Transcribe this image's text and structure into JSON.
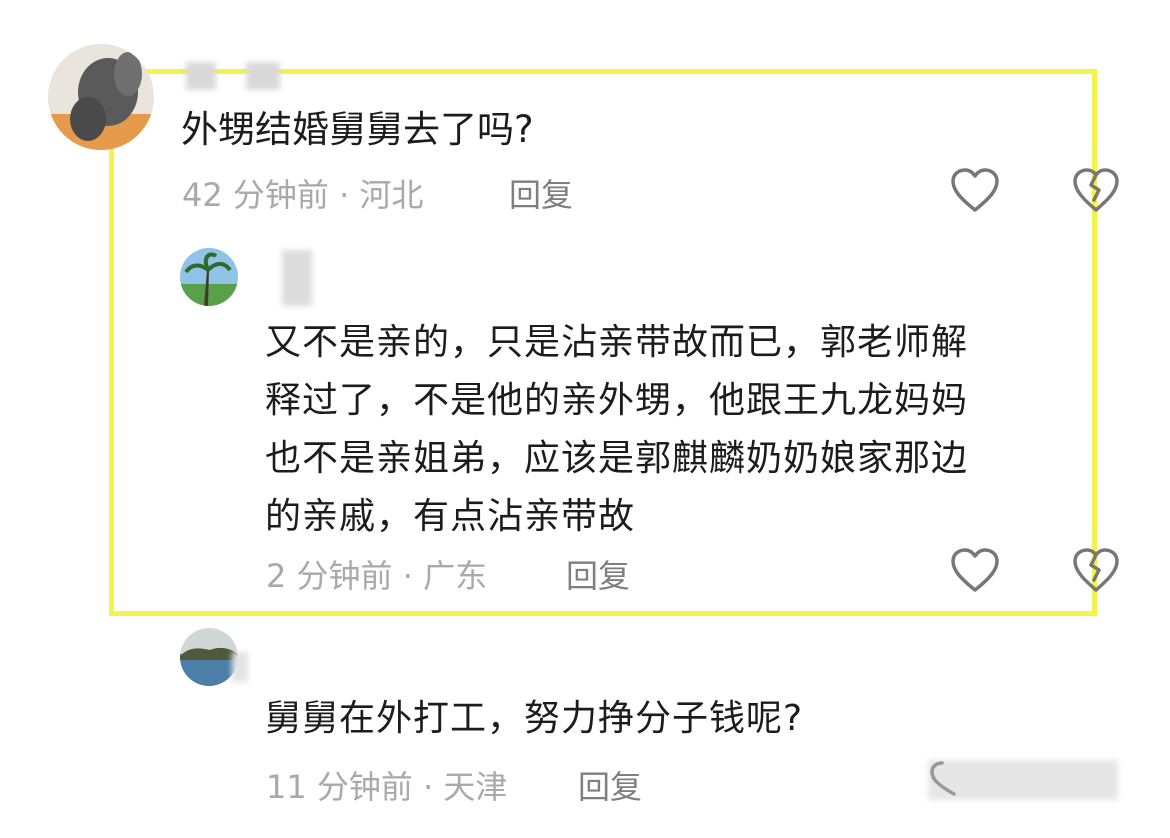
{
  "comments": [
    {
      "text": "外甥结婚舅舅去了吗?",
      "time": "42 分钟前",
      "location": "河北",
      "reply_label": "回复"
    },
    {
      "text_lines": [
        "又不是亲的，只是沾亲带故而已，郭老师解",
        "释过了，不是他的亲外甥，他跟王九龙妈妈",
        "也不是亲姐弟，应该是郭麒麟奶奶娘家那边",
        "的亲戚，有点沾亲带故"
      ],
      "time": "2 分钟前",
      "location": "广东",
      "reply_label": "回复"
    },
    {
      "text": "舅舅在外打工，努力挣分子钱呢?",
      "time": "11 分钟前",
      "location": "天津",
      "reply_label": "回复"
    }
  ],
  "separator": "·",
  "colors": {
    "highlight": "#f4f34a",
    "meta": "#a9a9a9",
    "icon": "#777777"
  },
  "icons": [
    "heart-icon",
    "dislike-icon"
  ]
}
